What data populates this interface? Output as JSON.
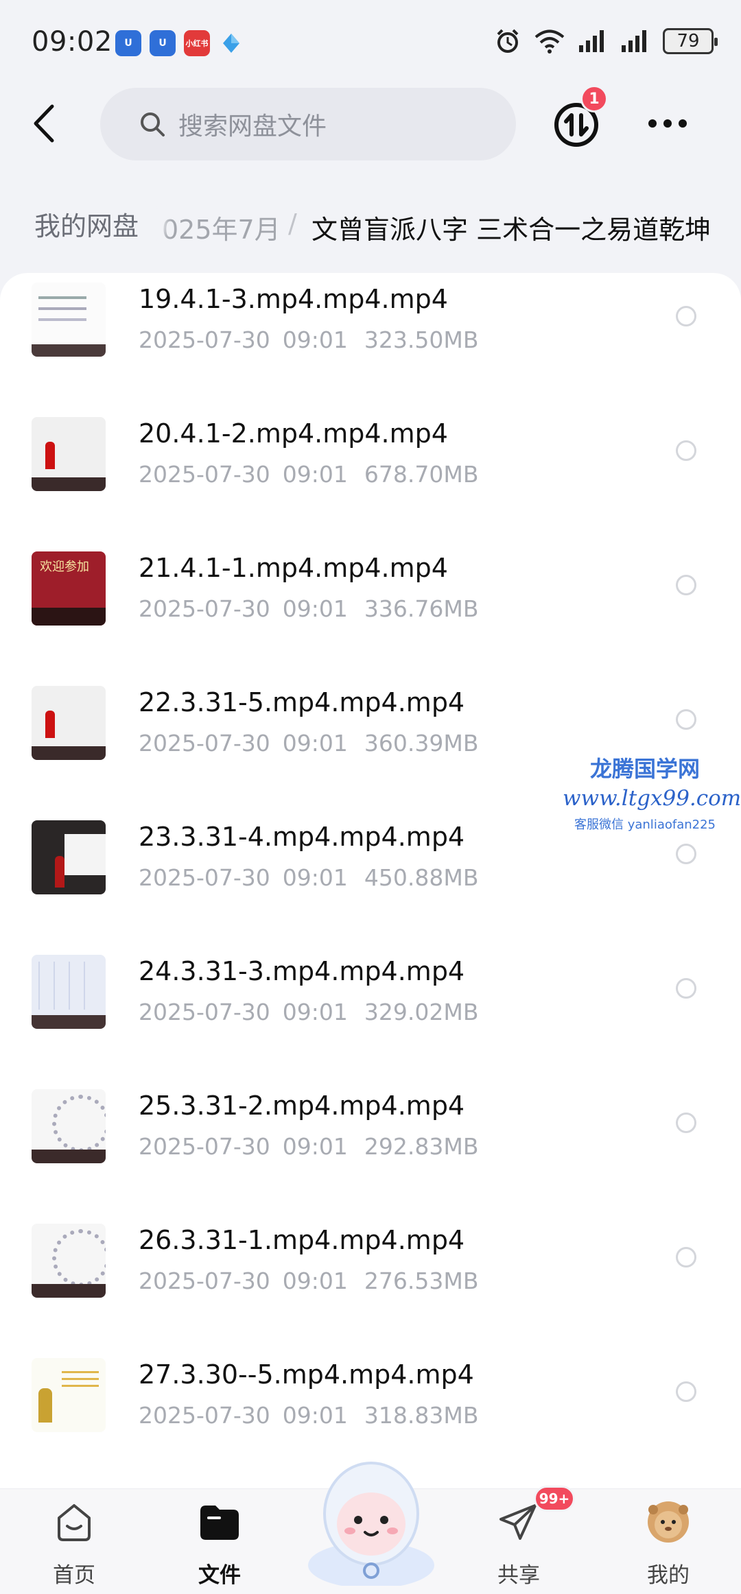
{
  "status_bar": {
    "time": "09:02",
    "apps": [
      {
        "icon": "app-shield-icon",
        "label": "U"
      },
      {
        "icon": "app-shield-icon",
        "label": "U"
      },
      {
        "icon": "xiaohongshu-icon",
        "label": "小红书"
      },
      {
        "icon": "drop-app-icon",
        "label": ""
      }
    ],
    "battery": "79"
  },
  "header": {
    "search_placeholder": "搜索网盘文件",
    "transfer_badge": "1"
  },
  "breadcrumb": {
    "root": "我的网盘",
    "middle": "025年7月",
    "separator": "/",
    "current": "文曾盲派八字  三术合一之易道乾坤"
  },
  "files": [
    {
      "name": "19.4.1-3.mp4.mp4.mp4",
      "date": "2025-07-30",
      "time": "09:01",
      "size": "323.50MB",
      "thumb": "slide"
    },
    {
      "name": "20.4.1-2.mp4.mp4.mp4",
      "date": "2025-07-30",
      "time": "09:01",
      "size": "678.70MB",
      "thumb": "board"
    },
    {
      "name": "21.4.1-1.mp4.mp4.mp4",
      "date": "2025-07-30",
      "time": "09:01",
      "size": "336.76MB",
      "thumb": "red"
    },
    {
      "name": "22.3.31-5.mp4.mp4.mp4",
      "date": "2025-07-30",
      "time": "09:01",
      "size": "360.39MB",
      "thumb": "board"
    },
    {
      "name": "23.3.31-4.mp4.mp4.mp4",
      "date": "2025-07-30",
      "time": "09:01",
      "size": "450.88MB",
      "thumb": "dark"
    },
    {
      "name": "24.3.31-3.mp4.mp4.mp4",
      "date": "2025-07-30",
      "time": "09:01",
      "size": "329.02MB",
      "thumb": "chart"
    },
    {
      "name": "25.3.31-2.mp4.mp4.mp4",
      "date": "2025-07-30",
      "time": "09:01",
      "size": "292.83MB",
      "thumb": "wheel"
    },
    {
      "name": "26.3.31-1.mp4.mp4.mp4",
      "date": "2025-07-30",
      "time": "09:01",
      "size": "276.53MB",
      "thumb": "wheel"
    },
    {
      "name": "27.3.30--5.mp4.mp4.mp4",
      "date": "2025-07-30",
      "time": "09:01",
      "size": "318.83MB",
      "thumb": "yellow"
    }
  ],
  "watermark": {
    "title": "龙腾国学网",
    "url": "www.ltgx99.com",
    "contact": "客服微信 yanliaofan225"
  },
  "bottom_nav": {
    "items": [
      {
        "label": "首页",
        "icon": "home-icon",
        "active": false
      },
      {
        "label": "文件",
        "icon": "folder-icon",
        "active": true
      },
      {
        "label": "共享",
        "icon": "paper-plane-icon",
        "active": false
      },
      {
        "label": "我的",
        "icon": "avatar-icon",
        "active": false
      }
    ],
    "share_badge": "99+"
  },
  "colors": {
    "background": "#f2f3f7",
    "badge": "#f24a5d",
    "watermark": "#3b74d6"
  }
}
